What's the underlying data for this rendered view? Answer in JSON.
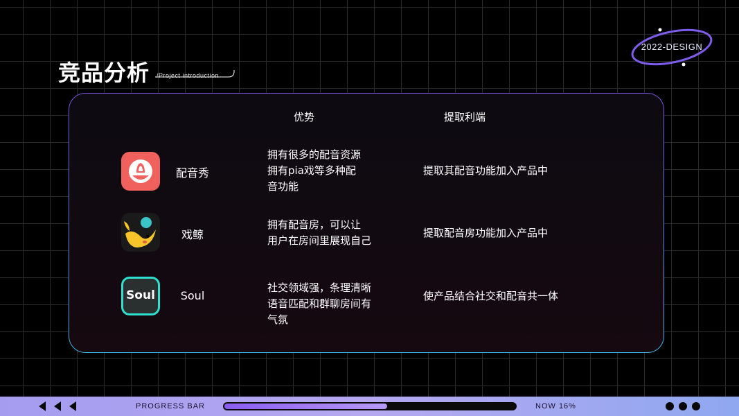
{
  "brand": {
    "label": "2022-DESIGN"
  },
  "header": {
    "title": "竞品分析",
    "subtitle": "/Project introduction"
  },
  "table": {
    "col_advantage": "优势",
    "col_extract": "提取利端",
    "rows": [
      {
        "name": "配音秀",
        "advantage": [
          "拥有很多的配音资源",
          "拥有pia戏等多种配",
          "音功能"
        ],
        "extract": "提取其配音功能加入产品中",
        "icon": "peiyinxiu-app-icon"
      },
      {
        "name": "戏鲸",
        "advantage": [
          "拥有配音房，可以让",
          "用户在房间里展现自己"
        ],
        "extract": "提取配音房功能加入产品中",
        "icon": "xijing-app-icon"
      },
      {
        "name": "Soul",
        "advantage": [
          "社交领域强，条理清晰",
          "语音匹配和群聊房间有",
          "气氛"
        ],
        "extract": "使产品结合社交和配音共一体",
        "icon": "soul-app-icon",
        "icon_text": "Soul"
      }
    ]
  },
  "footer": {
    "progress_label": "PROGRESS BAR",
    "progress_value": 0.16,
    "now_label": "NOW 16%"
  },
  "colors": {
    "accent_purple": "#8a5cf0",
    "accent_blue": "#3fb6e8",
    "footer_bg": "#a59cf0"
  }
}
